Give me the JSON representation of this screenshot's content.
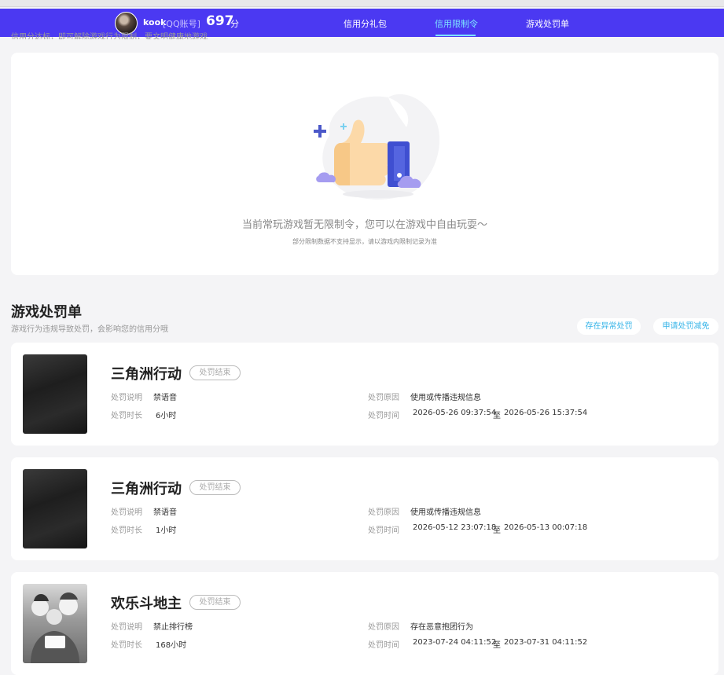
{
  "header": {
    "username": "kook",
    "account_type": "[QQ账号]",
    "score": "697",
    "score_unit": "分",
    "nav": [
      "信用分礼包",
      "信用限制令",
      "游戏处罚单"
    ],
    "active_nav": "信用限制令"
  },
  "cut_text": "信用分达标，即可解除游戏行为限制，要文明健康地游戏",
  "restriction": {
    "empty_message": "当前常玩游戏暂无限制令，您可以在游戏中自由玩耍～",
    "empty_sub": "部分限制数据不支持显示，请以游戏内限制记录为准"
  },
  "penalty_section": {
    "title": "游戏处罚单",
    "description": "游戏行为违规导致处罚，会影响您的信用分哦",
    "actions": [
      "存在异常处罚",
      "申请处罚减免"
    ],
    "labels": {
      "desc": "处罚说明",
      "duration": "处罚时长",
      "reason": "处罚原因",
      "time": "处罚时间",
      "to": "至"
    },
    "items": [
      {
        "game": "三角洲行动",
        "status": "处罚结束",
        "penalty": "禁语音",
        "duration": "6小时",
        "reason": "使用或传播违规信息",
        "start": "2026-05-26 09:37:54",
        "end": "2026-05-26 15:37:54"
      },
      {
        "game": "三角洲行动",
        "status": "处罚结束",
        "penalty": "禁语音",
        "duration": "1小时",
        "reason": "使用或传播违规信息",
        "start": "2026-05-12 23:07:18",
        "end": "2026-05-13 00:07:18"
      },
      {
        "game": "欢乐斗地主",
        "status": "处罚结束",
        "penalty": "禁止排行榜",
        "duration": "168小时",
        "reason": "存在恶意抱团行为",
        "start": "2023-07-24 04:11:52",
        "end": "2023-07-31 04:11:52"
      }
    ]
  },
  "colors": {
    "header_bg": "#4b39f2",
    "active_nav": "#7de3ff",
    "pill_text": "#36b4e8"
  }
}
